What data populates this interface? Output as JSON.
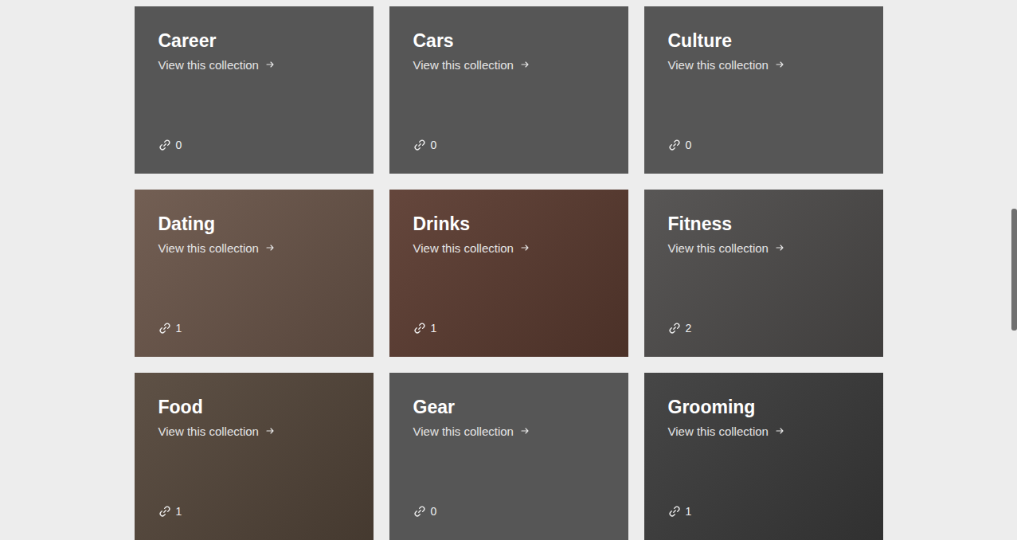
{
  "collections": [
    {
      "title": "Career",
      "link_text": "View this collection",
      "count": "0",
      "image": false,
      "color": "#565656"
    },
    {
      "title": "Cars",
      "link_text": "View this collection",
      "count": "0",
      "image": false,
      "color": "#565656"
    },
    {
      "title": "Culture",
      "link_text": "View this collection",
      "count": "0",
      "image": false,
      "color": "#565656"
    },
    {
      "title": "Dating",
      "link_text": "View this collection",
      "count": "1",
      "image": true,
      "color": "#6a5549"
    },
    {
      "title": "Drinks",
      "link_text": "View this collection",
      "count": "1",
      "image": true,
      "color": "#5b3b30"
    },
    {
      "title": "Fitness",
      "link_text": "View this collection",
      "count": "2",
      "image": true,
      "color": "#4e4c4b"
    },
    {
      "title": "Food",
      "link_text": "View this collection",
      "count": "1",
      "image": true,
      "color": "#54463a"
    },
    {
      "title": "Gear",
      "link_text": "View this collection",
      "count": "0",
      "image": false,
      "color": "#565656"
    },
    {
      "title": "Grooming",
      "link_text": "View this collection",
      "count": "1",
      "image": true,
      "color": "#3b3b3b"
    }
  ]
}
